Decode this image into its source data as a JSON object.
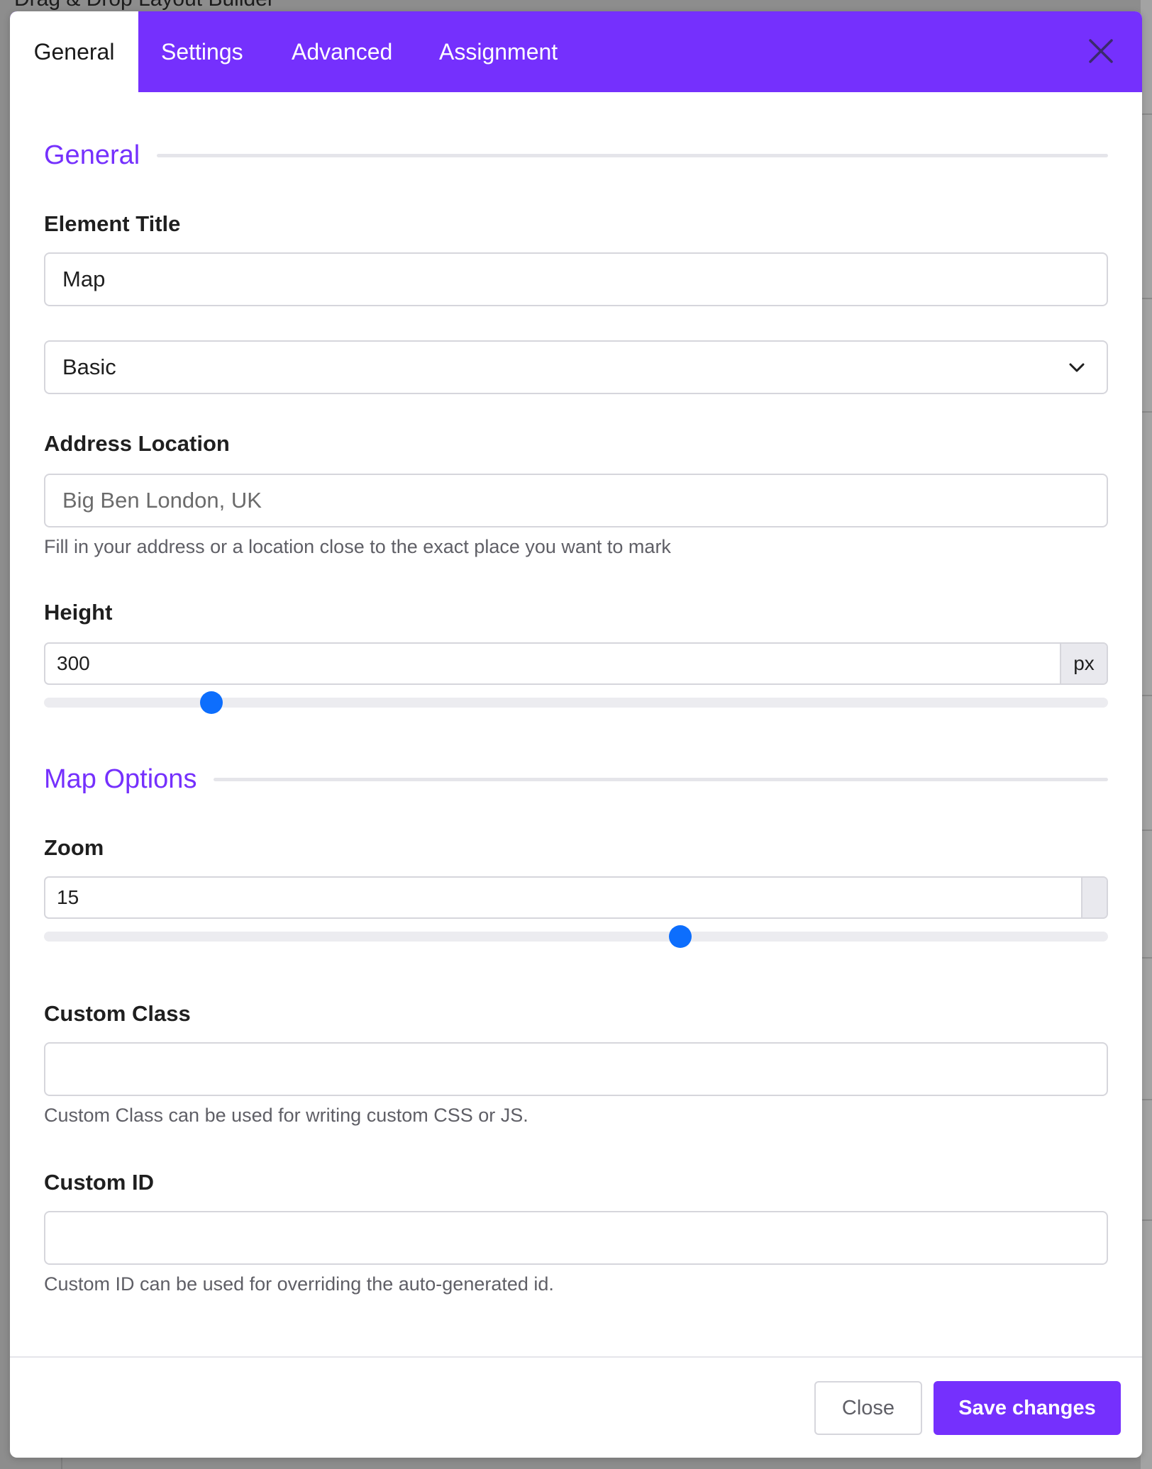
{
  "background": {
    "page_title": "Drag & Drop Layout Builder"
  },
  "modal": {
    "tabs": [
      {
        "label": "General",
        "active": true
      },
      {
        "label": "Settings",
        "active": false
      },
      {
        "label": "Advanced",
        "active": false
      },
      {
        "label": "Assignment",
        "active": false
      }
    ],
    "close_icon": "close-x-icon",
    "accent_color": "#7530fd",
    "slider_color": "#0d6efd"
  },
  "general": {
    "section_title": "General",
    "element_title": {
      "label": "Element Title",
      "value": "Map"
    },
    "type_select": {
      "value": "Basic",
      "icon": "chevron-down-icon"
    },
    "address": {
      "label": "Address Location",
      "placeholder": "Big Ben London, UK",
      "help": "Fill in your address or a location close to the exact place you want to mark"
    },
    "height": {
      "label": "Height",
      "value": "300",
      "unit": "px",
      "slider_fraction": 0.157
    }
  },
  "map_options": {
    "section_title": "Map Options",
    "zoom": {
      "label": "Zoom",
      "value": "15",
      "unit": "",
      "slider_fraction": 0.598
    },
    "custom_class": {
      "label": "Custom Class",
      "value": "",
      "help": "Custom Class can be used for writing custom CSS or JS."
    },
    "custom_id": {
      "label": "Custom ID",
      "value": "",
      "help": "Custom ID can be used for overriding the auto-generated id."
    }
  },
  "footer": {
    "close_label": "Close",
    "save_label": "Save changes"
  }
}
